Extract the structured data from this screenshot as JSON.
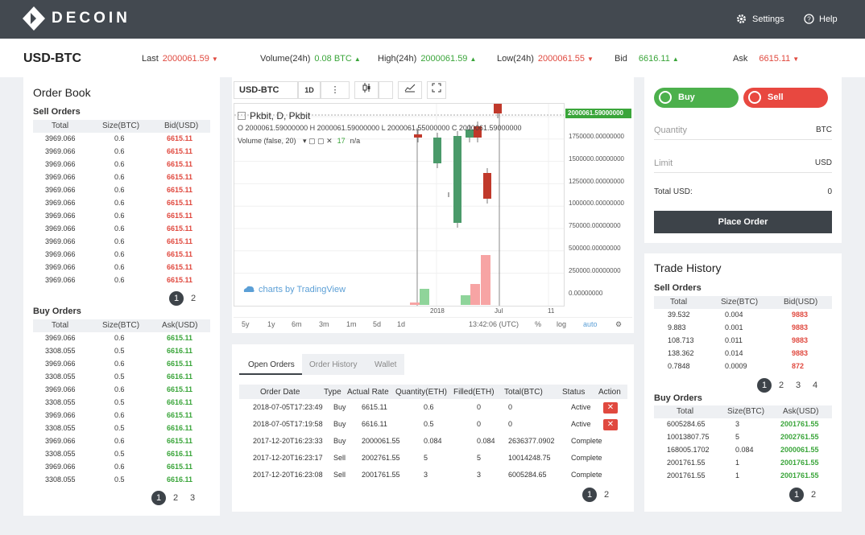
{
  "header": {
    "logo_text": "DECOIN",
    "settings_label": "Settings",
    "help_label": "Help"
  },
  "ticker": {
    "pair": "USD-BTC",
    "last_label": "Last",
    "last_value": "2000061.59",
    "volume_label": "Volume(24h)",
    "volume_value": "0.08 BTC",
    "high_label": "High(24h)",
    "high_value": "2000061.59",
    "low_label": "Low(24h)",
    "low_value": "2000061.55",
    "bid_label": "Bid",
    "bid_value": "6616.11",
    "ask_label": "Ask",
    "ask_value": "6615.11"
  },
  "order_book": {
    "title": "Order Book",
    "sell_title": "Sell Orders",
    "buy_title": "Buy Orders",
    "sell_headers": [
      "Total",
      "Size(BTC)",
      "Bid(USD)"
    ],
    "buy_headers": [
      "Total",
      "Size(BTC)",
      "Ask(USD)"
    ],
    "sell_rows": [
      [
        "3969.066",
        "0.6",
        "6615.11"
      ],
      [
        "3969.066",
        "0.6",
        "6615.11"
      ],
      [
        "3969.066",
        "0.6",
        "6615.11"
      ],
      [
        "3969.066",
        "0.6",
        "6615.11"
      ],
      [
        "3969.066",
        "0.6",
        "6615.11"
      ],
      [
        "3969.066",
        "0.6",
        "6615.11"
      ],
      [
        "3969.066",
        "0.6",
        "6615.11"
      ],
      [
        "3969.066",
        "0.6",
        "6615.11"
      ],
      [
        "3969.066",
        "0.6",
        "6615.11"
      ],
      [
        "3969.066",
        "0.6",
        "6615.11"
      ],
      [
        "3969.066",
        "0.6",
        "6615.11"
      ],
      [
        "3969.066",
        "0.6",
        "6615.11"
      ]
    ],
    "buy_rows": [
      [
        "3969.066",
        "0.6",
        "6615.11"
      ],
      [
        "3308.055",
        "0.5",
        "6616.11"
      ],
      [
        "3969.066",
        "0.6",
        "6615.11"
      ],
      [
        "3308.055",
        "0.5",
        "6616.11"
      ],
      [
        "3969.066",
        "0.6",
        "6615.11"
      ],
      [
        "3308.055",
        "0.5",
        "6616.11"
      ],
      [
        "3969.066",
        "0.6",
        "6615.11"
      ],
      [
        "3308.055",
        "0.5",
        "6616.11"
      ],
      [
        "3969.066",
        "0.6",
        "6615.11"
      ],
      [
        "3308.055",
        "0.5",
        "6616.11"
      ],
      [
        "3969.066",
        "0.6",
        "6615.11"
      ],
      [
        "3308.055",
        "0.5",
        "6616.11"
      ]
    ],
    "sell_pages": [
      "1",
      "2"
    ],
    "buy_pages": [
      "1",
      "2",
      "3"
    ]
  },
  "chart": {
    "symbol": "USD-BTC",
    "interval": "1D",
    "legend_title": "Pkbit, D, Pkbit",
    "ohlc": "O 2000061.59000000  H 2000061.59000000  L 2000061.55000000  C 2000061.59000000",
    "volume_label": "Volume (false, 20)",
    "volume_value": "17",
    "volume_na": "n/a",
    "price_tag": "2000061.59000000",
    "y_ticks": [
      "1750000.00000000",
      "1500000.00000000",
      "1250000.00000000",
      "1000000.00000000",
      "750000.00000000",
      "500000.00000000",
      "250000.00000000",
      "0.00000000"
    ],
    "x_ticks": [
      "2018",
      "Jul",
      "11"
    ],
    "watermark": "charts by TradingView",
    "timeframes": [
      "5y",
      "1y",
      "6m",
      "3m",
      "1m",
      "5d",
      "1d"
    ],
    "time": "13:42:06 (UTC)",
    "pct": "%",
    "log": "log",
    "auto": "auto"
  },
  "orders": {
    "tabs": [
      "Open Orders",
      "Order History",
      "Wallet"
    ],
    "headers": [
      "Order Date",
      "Type",
      "Actual Rate",
      "Quantity(ETH)",
      "Filled(ETH)",
      "Total(BTC)",
      "Status",
      "Action"
    ],
    "rows": [
      [
        "2018-07-05T17:23:49",
        "Buy",
        "6615.11",
        "0.6",
        "0",
        "0",
        "Active"
      ],
      [
        "2018-07-05T17:19:58",
        "Buy",
        "6616.11",
        "0.5",
        "0",
        "0",
        "Active"
      ],
      [
        "2017-12-20T16:23:33",
        "Buy",
        "2000061.55",
        "0.084",
        "0.084",
        "2636377.0902",
        "Complete"
      ],
      [
        "2017-12-20T16:23:17",
        "Sell",
        "2002761.55",
        "5",
        "5",
        "10014248.75",
        "Complete"
      ],
      [
        "2017-12-20T16:23:08",
        "Sell",
        "2001761.55",
        "3",
        "3",
        "6005284.65",
        "Complete"
      ]
    ],
    "pages": [
      "1",
      "2"
    ],
    "cancel_icon": "✕"
  },
  "trade_form": {
    "buy_label": "Buy",
    "sell_label": "Sell",
    "quantity_label": "Quantity",
    "quantity_unit": "BTC",
    "limit_label": "Limit",
    "limit_unit": "USD",
    "total_label": "Total USD:",
    "total_value": "0",
    "place_label": "Place Order"
  },
  "trade_history": {
    "title": "Trade History",
    "sell_title": "Sell Orders",
    "buy_title": "Buy Orders",
    "sell_headers": [
      "Total",
      "Size(BTC)",
      "Bid(USD)"
    ],
    "buy_headers": [
      "Total",
      "Size(BTC)",
      "Ask(USD)"
    ],
    "sell_rows": [
      [
        "39.532",
        "0.004",
        "9883"
      ],
      [
        "9.883",
        "0.001",
        "9883"
      ],
      [
        "108.713",
        "0.011",
        "9883"
      ],
      [
        "138.362",
        "0.014",
        "9883"
      ],
      [
        "0.7848",
        "0.0009",
        "872"
      ]
    ],
    "buy_rows": [
      [
        "6005284.65",
        "3",
        "2001761.55"
      ],
      [
        "10013807.75",
        "5",
        "2002761.55"
      ],
      [
        "168005.1702",
        "0.084",
        "2000061.55"
      ],
      [
        "2001761.55",
        "1",
        "2001761.55"
      ],
      [
        "2001761.55",
        "1",
        "2001761.55"
      ]
    ],
    "sell_pages": [
      "1",
      "2",
      "3",
      "4"
    ],
    "buy_pages": [
      "1",
      "2"
    ]
  },
  "colors": {
    "accent_green": "#3aa53a",
    "accent_red": "#e0493f",
    "topbar": "#434950"
  }
}
